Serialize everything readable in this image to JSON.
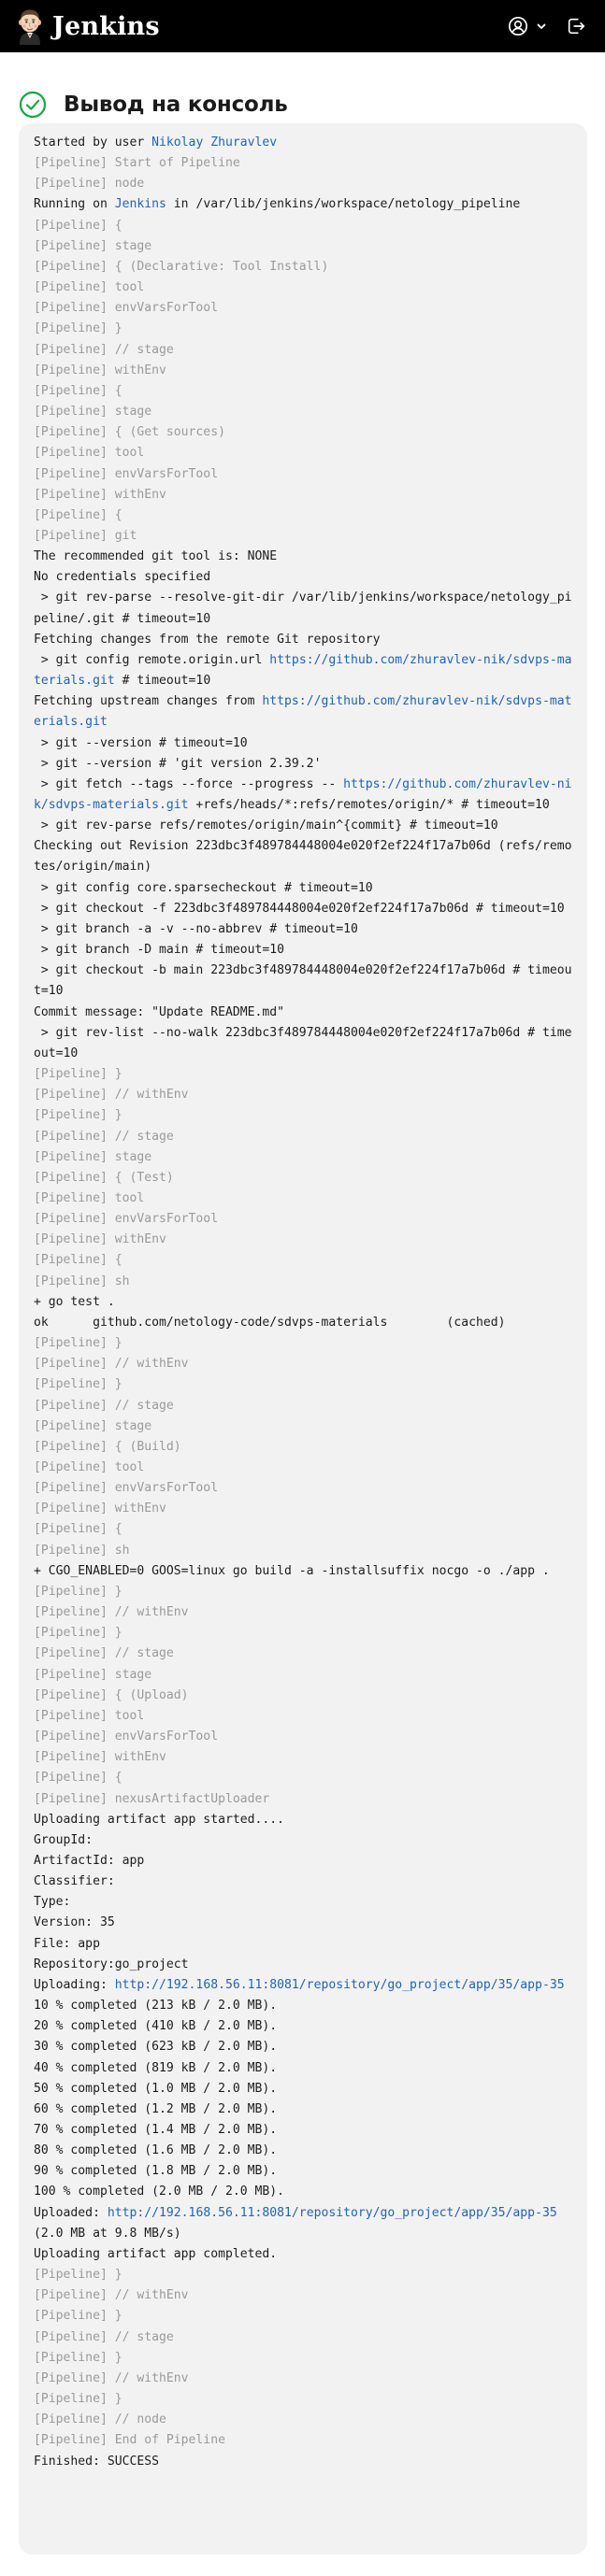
{
  "header": {
    "brand": "Jenkins"
  },
  "icons": {
    "logo": "jenkins-butler-logo",
    "user": "user-circle-icon",
    "dropdown": "chevron-down-icon",
    "logout": "logout-icon",
    "status": "success-check-circle-icon"
  },
  "colors": {
    "topbar": "#000000",
    "success": "#1ea446",
    "link": "#1f64b8",
    "pipeline_text": "#9a9a9a",
    "console_bg": "#f2f2f2"
  },
  "page": {
    "title": "Вывод на консоль"
  },
  "console": {
    "lines": [
      [
        {
          "t": "Started by user "
        },
        {
          "t": "Nikolay Zhuravlev",
          "link": true
        }
      ],
      [
        {
          "t": "[Pipeline] Start of Pipeline",
          "p": true
        }
      ],
      [
        {
          "t": "[Pipeline] node",
          "p": true
        }
      ],
      [
        {
          "t": "Running on "
        },
        {
          "t": "Jenkins",
          "link": true
        },
        {
          "t": " in /var/lib/jenkins/workspace/netology_pipeline"
        }
      ],
      [
        {
          "t": "[Pipeline] {",
          "p": true
        }
      ],
      [
        {
          "t": "[Pipeline] stage",
          "p": true
        }
      ],
      [
        {
          "t": "[Pipeline] { (Declarative: Tool Install)",
          "p": true
        }
      ],
      [
        {
          "t": "[Pipeline] tool",
          "p": true
        }
      ],
      [
        {
          "t": "[Pipeline] envVarsForTool",
          "p": true
        }
      ],
      [
        {
          "t": "[Pipeline] }",
          "p": true
        }
      ],
      [
        {
          "t": "[Pipeline] // stage",
          "p": true
        }
      ],
      [
        {
          "t": "[Pipeline] withEnv",
          "p": true
        }
      ],
      [
        {
          "t": "[Pipeline] {",
          "p": true
        }
      ],
      [
        {
          "t": "[Pipeline] stage",
          "p": true
        }
      ],
      [
        {
          "t": "[Pipeline] { (Get sources)",
          "p": true
        }
      ],
      [
        {
          "t": "[Pipeline] tool",
          "p": true
        }
      ],
      [
        {
          "t": "[Pipeline] envVarsForTool",
          "p": true
        }
      ],
      [
        {
          "t": "[Pipeline] withEnv",
          "p": true
        }
      ],
      [
        {
          "t": "[Pipeline] {",
          "p": true
        }
      ],
      [
        {
          "t": "[Pipeline] git",
          "p": true
        }
      ],
      [
        {
          "t": "The recommended git tool is: NONE"
        }
      ],
      [
        {
          "t": "No credentials specified"
        }
      ],
      [
        {
          "t": " > git rev-parse --resolve-git-dir /var/lib/jenkins/workspace/netology_pipeline/.git # timeout=10"
        }
      ],
      [
        {
          "t": "Fetching changes from the remote Git repository"
        }
      ],
      [
        {
          "t": " > git config remote.origin.url "
        },
        {
          "t": "https://github.com/zhuravlev-nik/sdvps-materials.git",
          "link": true
        },
        {
          "t": " # timeout=10"
        }
      ],
      [
        {
          "t": "Fetching upstream changes from "
        },
        {
          "t": "https://github.com/zhuravlev-nik/sdvps-materials.git",
          "link": true
        }
      ],
      [
        {
          "t": " > git --version # timeout=10"
        }
      ],
      [
        {
          "t": " > git --version # 'git version 2.39.2'"
        }
      ],
      [
        {
          "t": " > git fetch --tags --force --progress -- "
        },
        {
          "t": "https://github.com/zhuravlev-nik/sdvps-materials.git",
          "link": true
        },
        {
          "t": " +refs/heads/*:refs/remotes/origin/* # timeout=10"
        }
      ],
      [
        {
          "t": " > git rev-parse refs/remotes/origin/main^{commit} # timeout=10"
        }
      ],
      [
        {
          "t": "Checking out Revision 223dbc3f489784448004e020f2ef224f17a7b06d (refs/remotes/origin/main)"
        }
      ],
      [
        {
          "t": " > git config core.sparsecheckout # timeout=10"
        }
      ],
      [
        {
          "t": " > git checkout -f 223dbc3f489784448004e020f2ef224f17a7b06d # timeout=10"
        }
      ],
      [
        {
          "t": " > git branch -a -v --no-abbrev # timeout=10"
        }
      ],
      [
        {
          "t": " > git branch -D main # timeout=10"
        }
      ],
      [
        {
          "t": " > git checkout -b main 223dbc3f489784448004e020f2ef224f17a7b06d # timeout=10"
        }
      ],
      [
        {
          "t": "Commit message: \"Update README.md\""
        }
      ],
      [
        {
          "t": " > git rev-list --no-walk 223dbc3f489784448004e020f2ef224f17a7b06d # timeout=10"
        }
      ],
      [
        {
          "t": "[Pipeline] }",
          "p": true
        }
      ],
      [
        {
          "t": "[Pipeline] // withEnv",
          "p": true
        }
      ],
      [
        {
          "t": "[Pipeline] }",
          "p": true
        }
      ],
      [
        {
          "t": "[Pipeline] // stage",
          "p": true
        }
      ],
      [
        {
          "t": "[Pipeline] stage",
          "p": true
        }
      ],
      [
        {
          "t": "[Pipeline] { (Test)",
          "p": true
        }
      ],
      [
        {
          "t": "[Pipeline] tool",
          "p": true
        }
      ],
      [
        {
          "t": "[Pipeline] envVarsForTool",
          "p": true
        }
      ],
      [
        {
          "t": "[Pipeline] withEnv",
          "p": true
        }
      ],
      [
        {
          "t": "[Pipeline] {",
          "p": true
        }
      ],
      [
        {
          "t": "[Pipeline] sh",
          "p": true
        }
      ],
      [
        {
          "t": "+ go test ."
        }
      ],
      [
        {
          "t": "ok  \tgithub.com/netology-code/sdvps-materials\t(cached)"
        }
      ],
      [
        {
          "t": "[Pipeline] }",
          "p": true
        }
      ],
      [
        {
          "t": "[Pipeline] // withEnv",
          "p": true
        }
      ],
      [
        {
          "t": "[Pipeline] }",
          "p": true
        }
      ],
      [
        {
          "t": "[Pipeline] // stage",
          "p": true
        }
      ],
      [
        {
          "t": "[Pipeline] stage",
          "p": true
        }
      ],
      [
        {
          "t": "[Pipeline] { (Build)",
          "p": true
        }
      ],
      [
        {
          "t": "[Pipeline] tool",
          "p": true
        }
      ],
      [
        {
          "t": "[Pipeline] envVarsForTool",
          "p": true
        }
      ],
      [
        {
          "t": "[Pipeline] withEnv",
          "p": true
        }
      ],
      [
        {
          "t": "[Pipeline] {",
          "p": true
        }
      ],
      [
        {
          "t": "[Pipeline] sh",
          "p": true
        }
      ],
      [
        {
          "t": "+ CGO_ENABLED=0 GOOS=linux go build -a -installsuffix nocgo -o ./app ."
        }
      ],
      [
        {
          "t": "[Pipeline] }",
          "p": true
        }
      ],
      [
        {
          "t": "[Pipeline] // withEnv",
          "p": true
        }
      ],
      [
        {
          "t": "[Pipeline] }",
          "p": true
        }
      ],
      [
        {
          "t": "[Pipeline] // stage",
          "p": true
        }
      ],
      [
        {
          "t": "[Pipeline] stage",
          "p": true
        }
      ],
      [
        {
          "t": "[Pipeline] { (Upload)",
          "p": true
        }
      ],
      [
        {
          "t": "[Pipeline] tool",
          "p": true
        }
      ],
      [
        {
          "t": "[Pipeline] envVarsForTool",
          "p": true
        }
      ],
      [
        {
          "t": "[Pipeline] withEnv",
          "p": true
        }
      ],
      [
        {
          "t": "[Pipeline] {",
          "p": true
        }
      ],
      [
        {
          "t": "[Pipeline] nexusArtifactUploader",
          "p": true
        }
      ],
      [
        {
          "t": "Uploading artifact app started...."
        }
      ],
      [
        {
          "t": "GroupId:"
        }
      ],
      [
        {
          "t": "ArtifactId: app"
        }
      ],
      [
        {
          "t": "Classifier:"
        }
      ],
      [
        {
          "t": "Type:"
        }
      ],
      [
        {
          "t": "Version: 35"
        }
      ],
      [
        {
          "t": "File: app"
        }
      ],
      [
        {
          "t": "Repository:go_project"
        }
      ],
      [
        {
          "t": "Uploading: "
        },
        {
          "t": "http://192.168.56.11:8081/repository/go_project/app/35/app-35",
          "link": true
        }
      ],
      [
        {
          "t": "10 % completed (213 kB / 2.0 MB)."
        }
      ],
      [
        {
          "t": "20 % completed (410 kB / 2.0 MB)."
        }
      ],
      [
        {
          "t": "30 % completed (623 kB / 2.0 MB)."
        }
      ],
      [
        {
          "t": "40 % completed (819 kB / 2.0 MB)."
        }
      ],
      [
        {
          "t": "50 % completed (1.0 MB / 2.0 MB)."
        }
      ],
      [
        {
          "t": "60 % completed (1.2 MB / 2.0 MB)."
        }
      ],
      [
        {
          "t": "70 % completed (1.4 MB / 2.0 MB)."
        }
      ],
      [
        {
          "t": "80 % completed (1.6 MB / 2.0 MB)."
        }
      ],
      [
        {
          "t": "90 % completed (1.8 MB / 2.0 MB)."
        }
      ],
      [
        {
          "t": "100 % completed (2.0 MB / 2.0 MB)."
        }
      ],
      [
        {
          "t": "Uploaded: "
        },
        {
          "t": "http://192.168.56.11:8081/repository/go_project/app/35/app-35",
          "link": true
        },
        {
          "t": " (2.0 MB at 9.8 MB/s)"
        }
      ],
      [
        {
          "t": "Uploading artifact app completed."
        }
      ],
      [
        {
          "t": "[Pipeline] }",
          "p": true
        }
      ],
      [
        {
          "t": "[Pipeline] // withEnv",
          "p": true
        }
      ],
      [
        {
          "t": "[Pipeline] }",
          "p": true
        }
      ],
      [
        {
          "t": "[Pipeline] // stage",
          "p": true
        }
      ],
      [
        {
          "t": "[Pipeline] }",
          "p": true
        }
      ],
      [
        {
          "t": "[Pipeline] // withEnv",
          "p": true
        }
      ],
      [
        {
          "t": "[Pipeline] }",
          "p": true
        }
      ],
      [
        {
          "t": "[Pipeline] // node",
          "p": true
        }
      ],
      [
        {
          "t": "[Pipeline] End of Pipeline",
          "p": true
        }
      ],
      [
        {
          "t": "Finished: SUCCESS"
        }
      ]
    ]
  }
}
